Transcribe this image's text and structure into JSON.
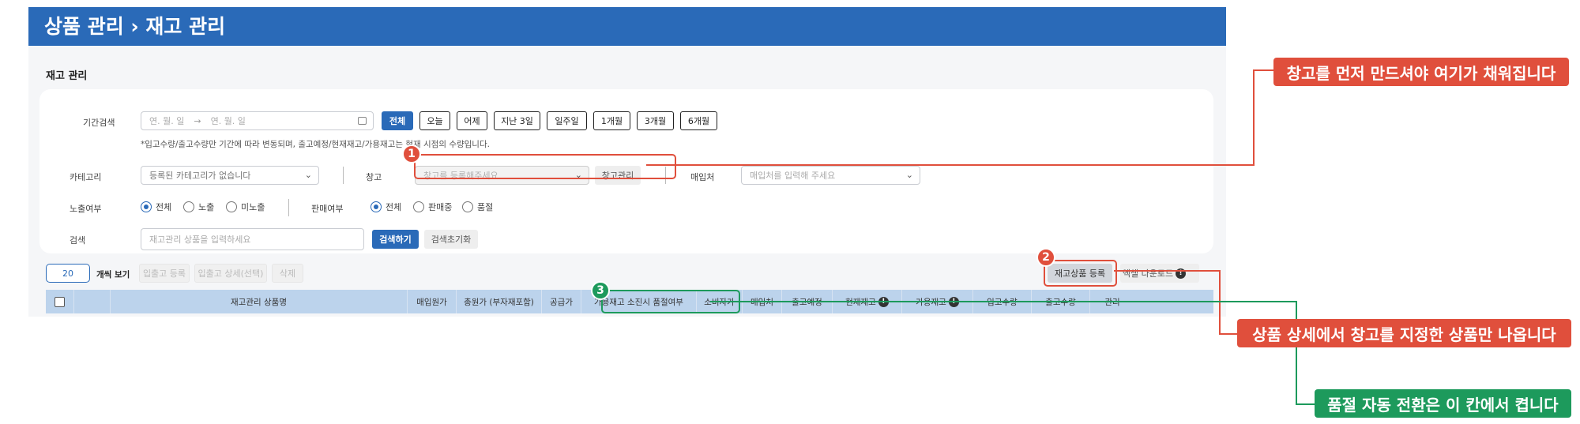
{
  "header": {
    "title": "상품 관리 › 재고 관리"
  },
  "section": {
    "label": "재고 관리"
  },
  "filters": {
    "period": {
      "label": "기간검색",
      "start_placeholder": "연. 월. 일",
      "end_placeholder": "연. 월. 일",
      "quick": [
        "전체",
        "오늘",
        "어제",
        "지난 3일",
        "일주일",
        "1개월",
        "3개월",
        "6개월"
      ],
      "selected": "전체",
      "note": "*입고수량/출고수량만 기간에 따라 변동되며, 출고예정/현재재고/가용재고는 현재 시점의 수량입니다."
    },
    "category": {
      "label": "카테고리",
      "value": "등록된 카테고리가 없습니다"
    },
    "warehouse": {
      "label": "창고",
      "placeholder": "창고를 등록해주세요",
      "manage_button": "창고관리"
    },
    "supplier": {
      "label": "매입처",
      "placeholder": "매입처를 입력해 주세요"
    },
    "exposure": {
      "label": "노출여부",
      "options": [
        "전체",
        "노출",
        "미노출"
      ],
      "selected": "전체"
    },
    "sale": {
      "label": "판매여부",
      "options": [
        "전체",
        "판매중",
        "품절"
      ],
      "selected": "전체"
    },
    "search": {
      "label": "검색",
      "placeholder": "재고관리 상품을 입력하세요",
      "search_button": "검색하기",
      "reset_button": "검색초기화"
    }
  },
  "toolbar": {
    "page_size": "20",
    "page_size_label": "개씩 보기",
    "inout_register": "입출고 등록",
    "inout_detail": "입출고 상세(선택)",
    "delete": "삭제",
    "register_stock_product": "재고상품 등록",
    "excel_download": "엑셀 다운로드"
  },
  "table": {
    "columns": [
      "재고관리 상품명",
      "매입원가",
      "총원가 (부자재포함)",
      "공급가",
      "가용재고 소진시 품절여부",
      "소비자가",
      "매입처",
      "출고예정",
      "현재재고",
      "가용재고",
      "입고수량",
      "출고수량",
      "관리"
    ]
  },
  "annotations": [
    {
      "number": "1",
      "text": "창고를 먼저 만드셔야 여기가 채워집니다",
      "color": "#e04f3c"
    },
    {
      "number": "2",
      "text": "상품 상세에서 창고를 지정한 상품만 나옵니다",
      "color": "#e04f3c"
    },
    {
      "number": "3",
      "text": "품절 자동 전환은 이 칸에서 켭니다",
      "color": "#1d9a5c"
    }
  ],
  "icons": {
    "info": "info-icon",
    "calendar": "calendar-icon",
    "chevron": "chevron-down-icon"
  }
}
